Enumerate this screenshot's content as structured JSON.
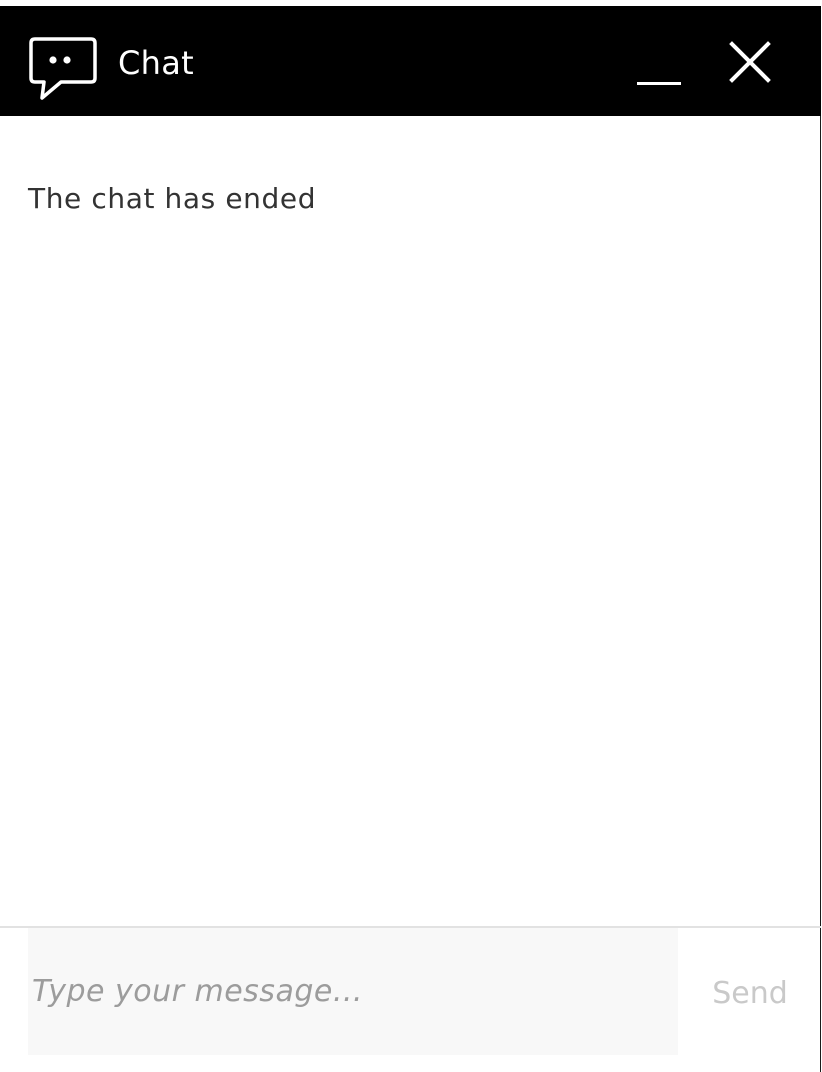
{
  "header": {
    "title": "Chat",
    "chat_icon": "chat-bubble-icon",
    "minimize_icon": "minimize-icon",
    "close_icon": "close-icon",
    "background_color": "#000000",
    "text_color": "#ffffff"
  },
  "messages": {
    "status": "The chat has ended"
  },
  "composer": {
    "value": "",
    "placeholder": "Type your message...",
    "send_label": "Send"
  }
}
